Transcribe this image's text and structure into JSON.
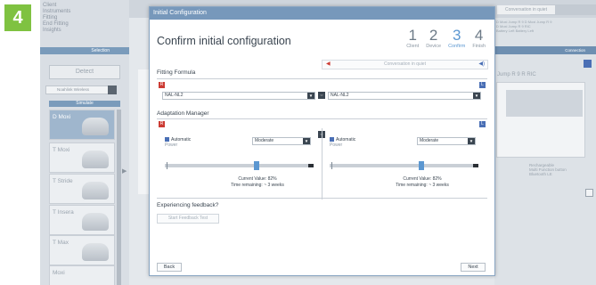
{
  "step_badge": "4",
  "background": {
    "nav_items": [
      "Client",
      "Instruments",
      "Fitting",
      "End Fitting",
      "Insights"
    ],
    "selection_label": "Selection",
    "detect_label": "Detect",
    "wireless_label": "Noahlink Wireless",
    "simulate_label": "Simulate",
    "devices": [
      "D Moxi",
      "T Moxi",
      "T Stride",
      "T Insera",
      "T Max",
      "Moxi"
    ],
    "conversation_top": "Conversation in quiet",
    "connection_label": "Connection",
    "right_text": [
      "D Moxi Jump R 9   D Moxi Jump R 9",
      "D Moxi Jump R 9 RIC",
      "Battery Left   Battery Left"
    ],
    "right_title": "Jump R 9 R RIC",
    "right_labels": [
      "Rechargeable",
      "Multi Function button",
      "Bluetooth LE"
    ]
  },
  "modal": {
    "titlebar": "Initial Configuration",
    "heading": "Confirm initial configuration",
    "steps": [
      {
        "num": "1",
        "label": "Client"
      },
      {
        "num": "2",
        "label": "Device"
      },
      {
        "num": "3",
        "label": "Confirm"
      },
      {
        "num": "4",
        "label": "Finish"
      }
    ],
    "active_step": 2,
    "conversation_placeholder": "Conversation in quiet",
    "fitting_formula_label": "Fitting Formula",
    "left_marker": "R",
    "right_marker": "L",
    "left_formula": "NAL-NL2",
    "right_formula": "NAL-NL2",
    "adaptation_label": "Adaptation Manager",
    "left_adapt": {
      "automatic_label": "Automatic",
      "power_label": "Power",
      "mode": "Moderate",
      "current_value": "Current Value: 82%",
      "time_remaining": "Time remaining: ~ 3 weeks",
      "level": 0.62
    },
    "right_adapt": {
      "automatic_label": "Automatic",
      "power_label": "Power",
      "mode": "Moderate",
      "current_value": "Current Value: 82%",
      "time_remaining": "Time remaining: ~ 3 weeks",
      "level": 0.62
    },
    "feedback_label": "Experiencing feedback?",
    "feedback_button": "Start Feedback Test",
    "back_button": "Back",
    "next_button": "Next"
  },
  "colors": {
    "badge": "#7fc241",
    "titlebar": "#7798bb",
    "red": "#cc3b33",
    "blue": "#4a6fb5",
    "accent": "#5b97d1"
  }
}
